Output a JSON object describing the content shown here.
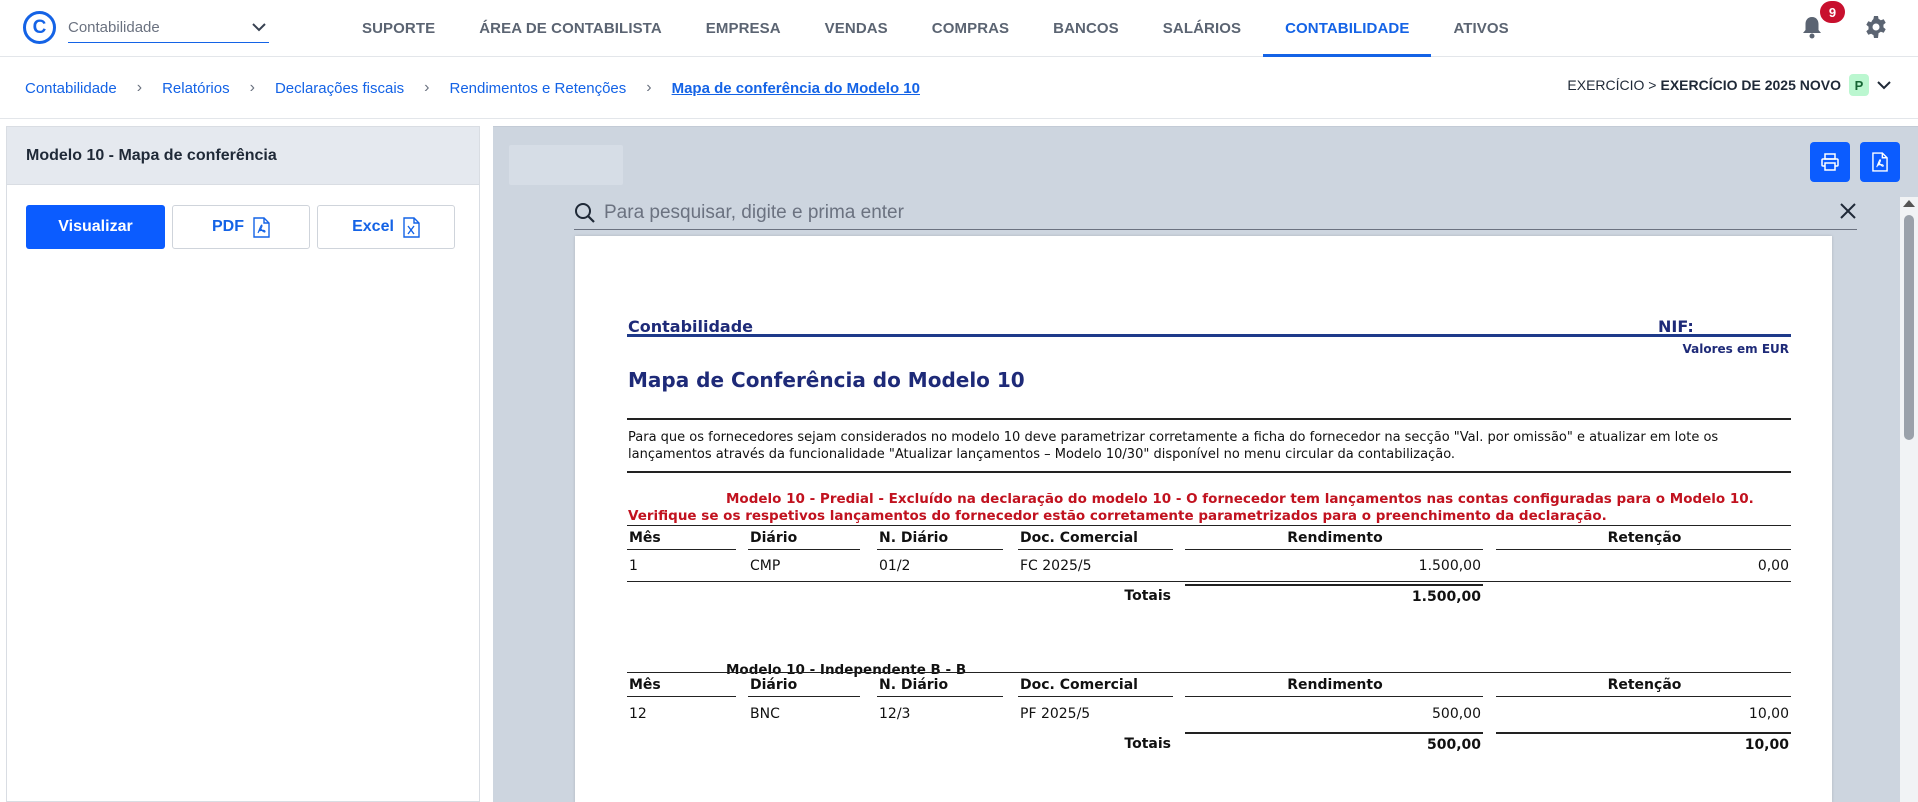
{
  "app": {
    "module_select": "Contabilidade",
    "notifications_count": "9"
  },
  "nav": {
    "items": [
      "SUPORTE",
      "ÁREA DE CONTABILISTA",
      "EMPRESA",
      "VENDAS",
      "COMPRAS",
      "BANCOS",
      "SALÁRIOS",
      "CONTABILIDADE",
      "ATIVOS"
    ],
    "active": "CONTABILIDADE"
  },
  "breadcrumb": {
    "items": [
      "Contabilidade",
      "Relatórios",
      "Declarações fiscais",
      "Rendimentos e Retenções",
      "Mapa de conferência do Modelo 10"
    ]
  },
  "exercise": {
    "prefix": "EXERCÍCIO >",
    "name": "EXERCÍCIO DE 2025 NOVO",
    "badge": "P"
  },
  "left_panel": {
    "title": "Modelo 10 - Mapa de conferência",
    "visualize_label": "Visualizar",
    "pdf_label": "PDF",
    "excel_label": "Excel"
  },
  "viewer": {
    "search_placeholder": "Para pesquisar, digite e prima enter"
  },
  "report": {
    "company": "Contabilidade",
    "nif_label": "NIF:",
    "currency_note": "Valores em EUR",
    "title": "Mapa de Conferência do Modelo 10",
    "note": "Para que os fornecedores sejam considerados no modelo 10 deve parametrizar corretamente a ficha do fornecedor na secção \"Val. por omissão\" e atualizar em lote os lançamentos através da funcionalidade \"Atualizar lançamentos – Modelo 10/30\" disponível no menu circular da contabilização.",
    "columns": [
      "Mês",
      "Diário",
      "N. Diário",
      "Doc. Comercial",
      "Rendimento",
      "Retenção"
    ],
    "totals_label": "Totais",
    "sections": [
      {
        "title_line1": "Modelo 10 - Predial - Excluído na declaração do modelo 10 - O fornecedor tem lançamentos nas contas configuradas para o Modelo 10.",
        "title_line2": "Verifique se os respetivos lançamentos do fornecedor estão corretamente parametrizados para o preenchimento da declaração.",
        "rows": [
          {
            "mes": "1",
            "diario": "CMP",
            "n_diario": "01/2",
            "doc": "FC 2025/5",
            "rendimento": "1.500,00",
            "retencao": "0,00"
          }
        ],
        "total_rendimento": "1.500,00",
        "total_retencao": ""
      },
      {
        "title_line1": "Modelo 10 - Independente B - B",
        "title_line2": "",
        "rows": [
          {
            "mes": "12",
            "diario": "BNC",
            "n_diario": "12/3",
            "doc": "PF 2025/5",
            "rendimento": "500,00",
            "retencao": "10,00"
          }
        ],
        "total_rendimento": "500,00",
        "total_retencao": "10,00"
      }
    ]
  }
}
